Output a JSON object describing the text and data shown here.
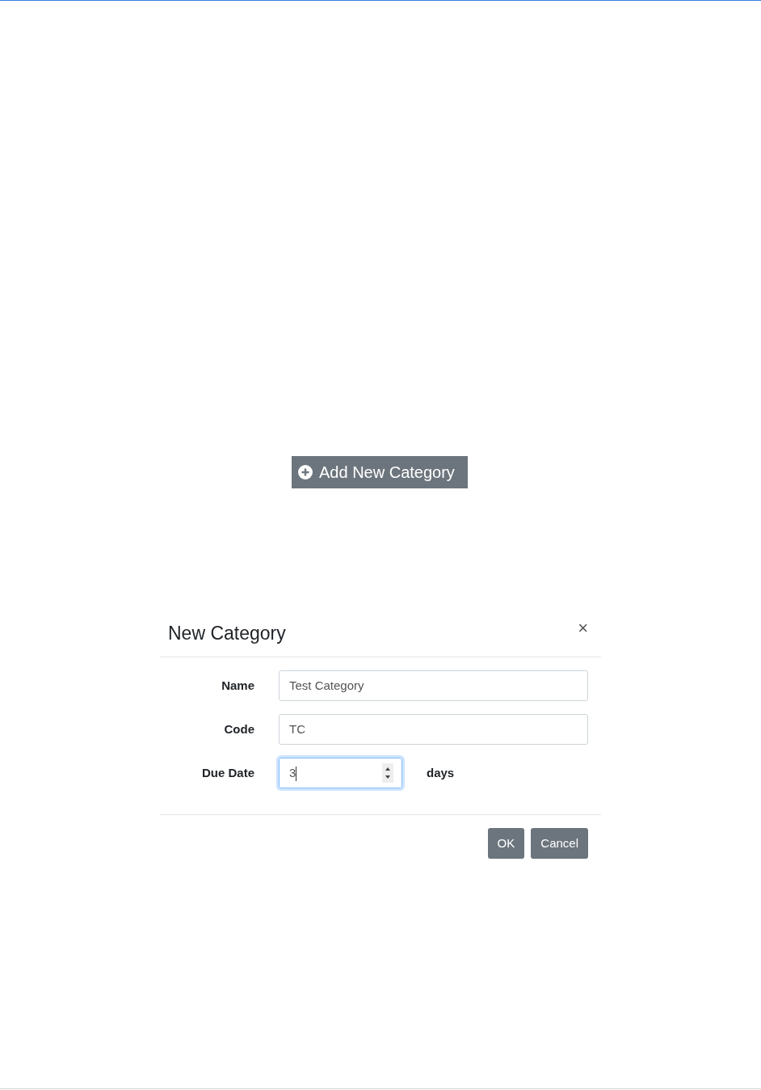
{
  "add_button": {
    "label": "Add New Category"
  },
  "dialog": {
    "title": "New Category",
    "close": "×",
    "fields": [
      {
        "label": "Name",
        "value": "Test Category",
        "kind": "text",
        "focused": false
      },
      {
        "label": "Code",
        "value": "TC",
        "kind": "text",
        "focused": false
      },
      {
        "label": "Due Date",
        "value": "3",
        "kind": "number",
        "focused": true,
        "suffix": "days"
      }
    ],
    "buttons": [
      "OK",
      "Cancel"
    ]
  }
}
